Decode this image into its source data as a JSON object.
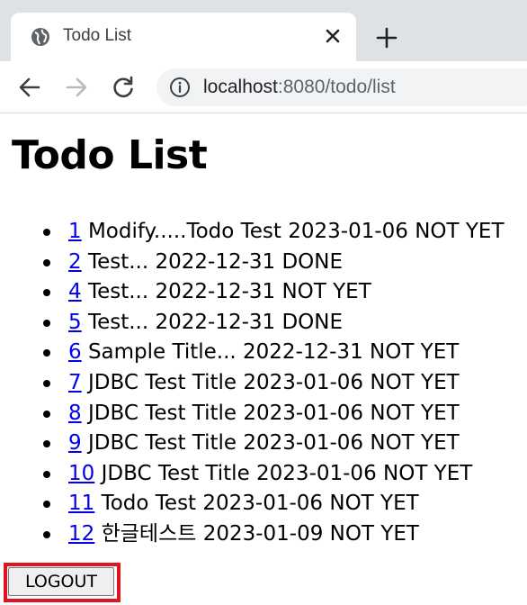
{
  "browser": {
    "tab_title": "Todo List",
    "url_host": "localhost",
    "url_path": ":8080/todo/list"
  },
  "page": {
    "title": "Todo List",
    "todos": [
      {
        "tno": "1",
        "text": " Modify.....Todo Test 2023-01-06 NOT YET"
      },
      {
        "tno": "2",
        "text": " Test... 2022-12-31 DONE"
      },
      {
        "tno": "4",
        "text": " Test... 2022-12-31 NOT YET"
      },
      {
        "tno": "5",
        "text": " Test... 2022-12-31 DONE"
      },
      {
        "tno": "6",
        "text": " Sample Title... 2022-12-31 NOT YET"
      },
      {
        "tno": "7",
        "text": " JDBC Test Title 2023-01-06 NOT YET"
      },
      {
        "tno": "8",
        "text": " JDBC Test Title 2023-01-06 NOT YET"
      },
      {
        "tno": "9",
        "text": " JDBC Test Title 2023-01-06 NOT YET"
      },
      {
        "tno": "10",
        "text": " JDBC Test Title 2023-01-06 NOT YET"
      },
      {
        "tno": "11",
        "text": " Todo Test 2023-01-06 NOT YET"
      },
      {
        "tno": "12",
        "text": " 한글테스트 2023-01-09 NOT YET"
      }
    ],
    "logout_label": "LOGOUT"
  },
  "icons": {
    "favicon": "globe-icon",
    "close": "close-icon",
    "new_tab": "plus-icon",
    "back": "back-arrow-icon",
    "forward": "forward-arrow-icon",
    "reload": "reload-icon",
    "info": "info-icon"
  },
  "colors": {
    "link": "#0000ee",
    "highlight_border": "#e0141e",
    "chrome_bg": "#dee1e6",
    "omnibox_bg": "#f1f3f4"
  }
}
